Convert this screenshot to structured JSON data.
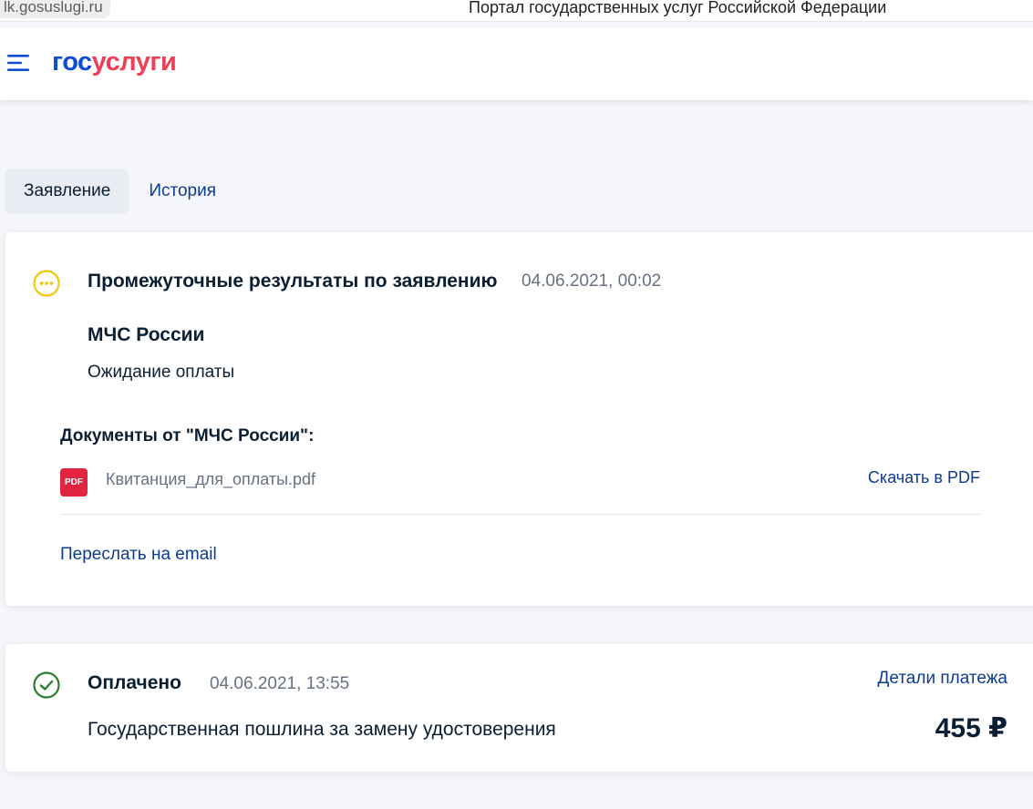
{
  "browser": {
    "url": "lk.gosuslugi.ru",
    "title": "Портал государственных услуг Российской Федерации"
  },
  "header": {
    "logo_part1": "гос",
    "logo_part2": "услуги"
  },
  "tabs": [
    {
      "label": "Заявление",
      "active": true
    },
    {
      "label": "История",
      "active": false
    }
  ],
  "interim": {
    "title": "Промежуточные результаты по заявлению",
    "date": "04.06.2021, 00:02",
    "org": "МЧС России",
    "status": "Ожидание оплаты",
    "docs_heading": "Документы от \"МЧС России\":",
    "file_badge": "PDF",
    "file_name": "Квитанция_для_оплаты.pdf",
    "download_label": "Скачать в PDF",
    "email_label": "Переслать на email"
  },
  "payment": {
    "status": "Оплачено",
    "date": "04.06.2021, 13:55",
    "details_label": "Детали платежа",
    "description": "Государственная пошлина за замену удостоверения",
    "amount": "455 ₽"
  },
  "colors": {
    "brand_blue": "#0d4cd3",
    "brand_red": "#ee3f58",
    "link": "#0d3b8e",
    "pending_yellow": "#f2c70c",
    "success_green": "#2e7d32",
    "pdf_red": "#e1253f"
  },
  "icons": {
    "menu": "hamburger-menu-icon",
    "pending": "ellipsis-circle-icon",
    "success": "check-circle-icon",
    "file": "pdf-file-icon"
  }
}
